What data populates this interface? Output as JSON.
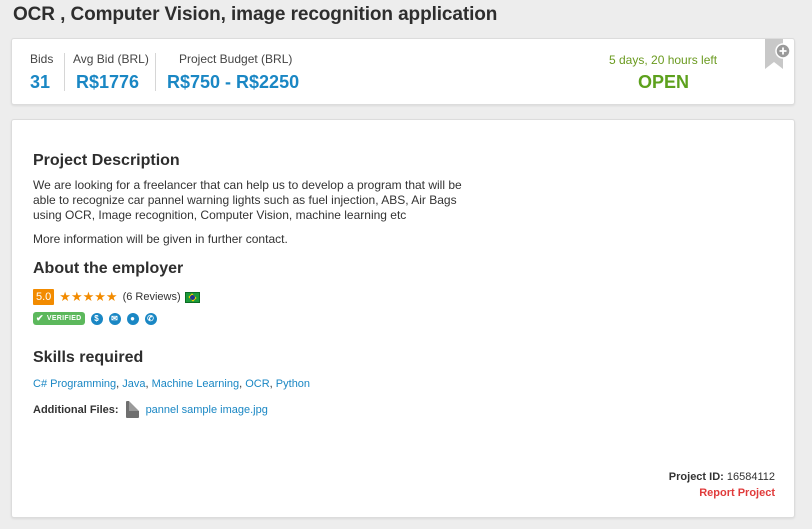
{
  "page": {
    "title": "OCR , Computer Vision, image recognition application"
  },
  "stats": {
    "bids_label": "Bids",
    "bids_value": "31",
    "avg_bid_label": "Avg Bid (BRL)",
    "avg_bid_value": "R$1776",
    "budget_label": "Project Budget (BRL)",
    "budget_value": "R$750 - R$2250",
    "time_left": "5 days, 20 hours left",
    "status": "OPEN"
  },
  "description": {
    "heading": "Project Description",
    "text": "We are looking for a freelancer that can help us to develop a program that will be able to recognize car pannel warning lights such as fuel injection, ABS, Air Bags using OCR, Image recognition, Computer Vision, machine learning etc",
    "more": "More information will be given in further contact."
  },
  "employer": {
    "heading": "About the employer",
    "score": "5.0",
    "stars": "★★★★★",
    "reviews": "(6 Reviews)",
    "verified_label": "VERIFIED",
    "verification_icons": [
      "dollar-icon",
      "email-icon",
      "user-icon",
      "phone-icon"
    ]
  },
  "skills": {
    "heading": "Skills required",
    "items": [
      "C# Programming",
      "Java",
      "Machine Learning",
      "OCR",
      "Python"
    ]
  },
  "files": {
    "label": "Additional Files:",
    "file_name": "pannel sample image.jpg"
  },
  "footer": {
    "project_id_label": "Project ID:",
    "project_id": "16584112",
    "report_label": "Report Project"
  },
  "colors": {
    "accent": "#1a87c4",
    "open_green": "#5da11d",
    "rating_orange": "#f28b00",
    "report_red": "#e03b3b"
  }
}
